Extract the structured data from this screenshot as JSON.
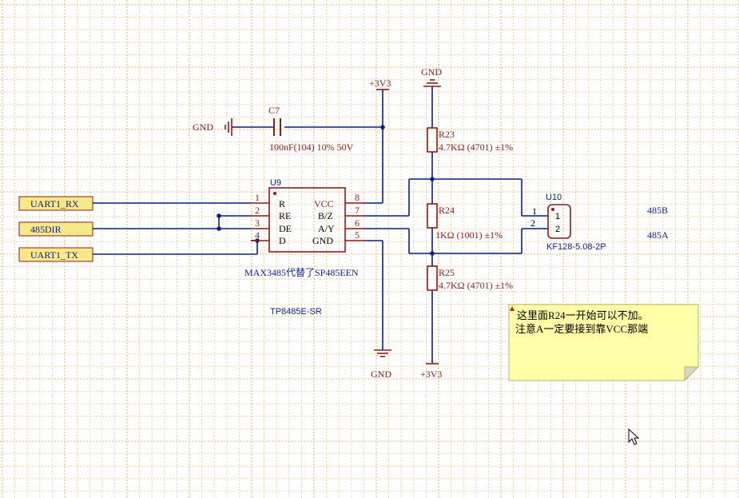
{
  "colors": {
    "background": "#ffffff",
    "grid_major": "#e0a040",
    "grid_minor": "#f0c890",
    "wire": "#0a1e8c",
    "component": "#8b1a1a",
    "designator": "#0a1e8c",
    "power": "#8b1a1a",
    "port_fill": "#f7e98a",
    "port_border": "#8b1a1a",
    "note_fill": "#ffffa8",
    "note_border": "#b8b070"
  },
  "ports": {
    "uart_rx": "UART1_RX",
    "dir": "485DIR",
    "uart_tx": "UART1_TX"
  },
  "power": {
    "vcc_top": "+3V3",
    "vcc_bottom": "+3V3",
    "gnd_cap": "GND",
    "gnd_top": "GND",
    "gnd_bottom": "GND"
  },
  "c7": {
    "designator": "C7",
    "value": "100nF(104) 10% 50V"
  },
  "u9": {
    "designator": "U9",
    "comment": "MAX3485代替了SP485EEN",
    "part": "TP8485E-SR",
    "pins_left": [
      {
        "num": "1",
        "name": "R"
      },
      {
        "num": "2",
        "name": "RE"
      },
      {
        "num": "3",
        "name": "DE"
      },
      {
        "num": "4",
        "name": "D"
      }
    ],
    "pins_right": [
      {
        "num": "8",
        "name": "VCC"
      },
      {
        "num": "7",
        "name": "B/Z"
      },
      {
        "num": "6",
        "name": "A/Y"
      },
      {
        "num": "5",
        "name": "GND"
      }
    ]
  },
  "r23": {
    "designator": "R23",
    "value": "4.7KΩ (4701) ±1%"
  },
  "r24": {
    "designator": "R24",
    "value": "1KΩ (1001) ±1%"
  },
  "r25": {
    "designator": "R25",
    "value": "4.7KΩ (4701) ±1%"
  },
  "u10": {
    "designator": "U10",
    "part": "KF128-5.08-2P",
    "pin1": "1",
    "pin2": "2",
    "inner1": "1",
    "inner2": "2"
  },
  "nets": {
    "b": "485B",
    "a": "485A"
  },
  "note": {
    "line1": "这里面R24一开始可以不加。",
    "line2": "注意A一定要接到靠VCC那端"
  }
}
